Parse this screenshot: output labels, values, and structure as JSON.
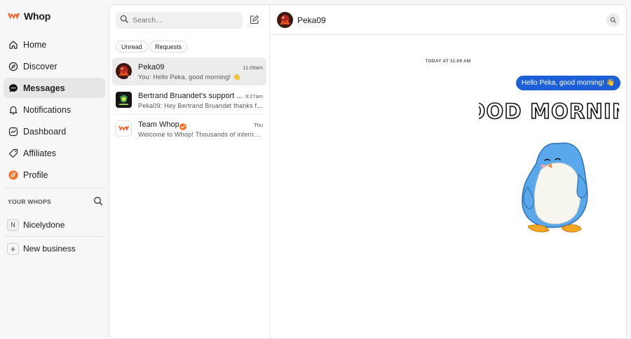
{
  "app": {
    "name": "Whop",
    "brand_color": "#ff5a1f"
  },
  "nav": {
    "items": [
      {
        "label": "Home",
        "icon": "home-icon"
      },
      {
        "label": "Discover",
        "icon": "compass-icon"
      },
      {
        "label": "Messages",
        "icon": "chat-bubble-icon",
        "active": true
      },
      {
        "label": "Notifications",
        "icon": "bell-icon"
      },
      {
        "label": "Dashboard",
        "icon": "dashboard-icon"
      },
      {
        "label": "Affiliates",
        "icon": "tag-icon"
      },
      {
        "label": "Profile",
        "icon": "profile-logo-icon"
      }
    ],
    "your_whops_label": "YOUR WHOPS",
    "whops": [
      {
        "initial": "N",
        "name": "Nicelydone"
      }
    ],
    "new_business_label": "New business"
  },
  "inbox": {
    "search_placeholder": "Search...",
    "filters": [
      "Unread",
      "Requests"
    ],
    "conversations": [
      {
        "name": "Peka09",
        "time": "11:09am",
        "preview": "You: Hello Peka, good morning! 👋",
        "active": true
      },
      {
        "name": "Bertrand Bruandet's support ...",
        "time": "9:27am",
        "preview": "Peka09: Hey Bertrand Bruandet thanks f..."
      },
      {
        "name": "Team Whop",
        "time": "Thu",
        "preview": "Welcome to Whop! Thousands of interne...",
        "verified": true
      }
    ]
  },
  "chat": {
    "contact_name": "Peka09",
    "date_separator": "TODAY AT 11:09 AM",
    "messages": [
      {
        "text": "Hello Peka, good morning! 👋",
        "from_me": true
      }
    ],
    "sticker": {
      "text": "GOOD MORNING",
      "subject": "penguin-sticker"
    },
    "bubble_color": "#1d5fd6"
  }
}
